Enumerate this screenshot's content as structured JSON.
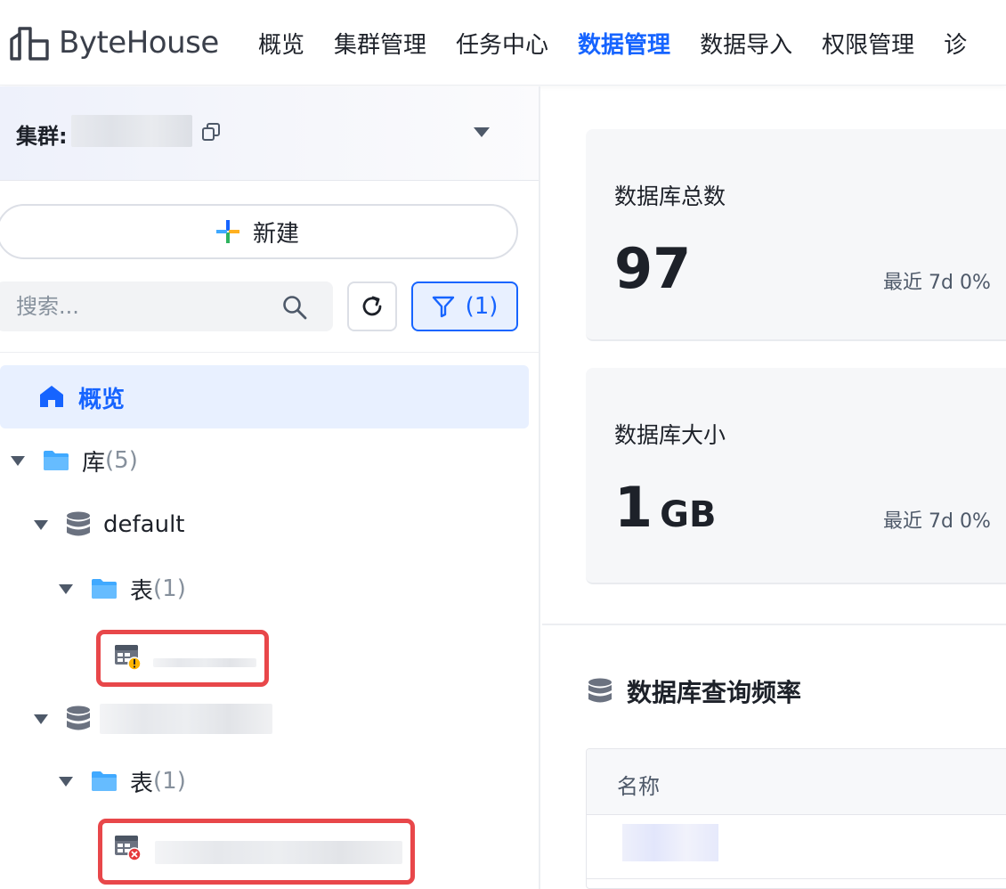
{
  "header": {
    "logo_text": "ByteHouse",
    "nav": [
      "概览",
      "集群管理",
      "任务中心",
      "数据管理",
      "数据导入",
      "权限管理",
      "诊"
    ],
    "active_nav": "数据管理"
  },
  "sidebar": {
    "cluster_label": "集群:",
    "new_button": "新建",
    "search_placeholder": "搜索...",
    "filter_label": "(1)",
    "overview_label": "概览",
    "tree": {
      "databases_label": "库",
      "databases_count": "(5)",
      "db1_name": "default",
      "db1_tables_label": "表",
      "db1_tables_count": "(1)",
      "db2_tables_label": "表",
      "db2_tables_count": "(1)"
    }
  },
  "main": {
    "db_total": {
      "title": "数据库总数",
      "value": "97",
      "trend": "最近 7d  0%"
    },
    "db_size": {
      "title": "数据库大小",
      "value": "1",
      "unit": "GB",
      "trend": "最近 7d  0%"
    },
    "query_section_title": "数据库查询频率",
    "table_header_name": "名称"
  }
}
